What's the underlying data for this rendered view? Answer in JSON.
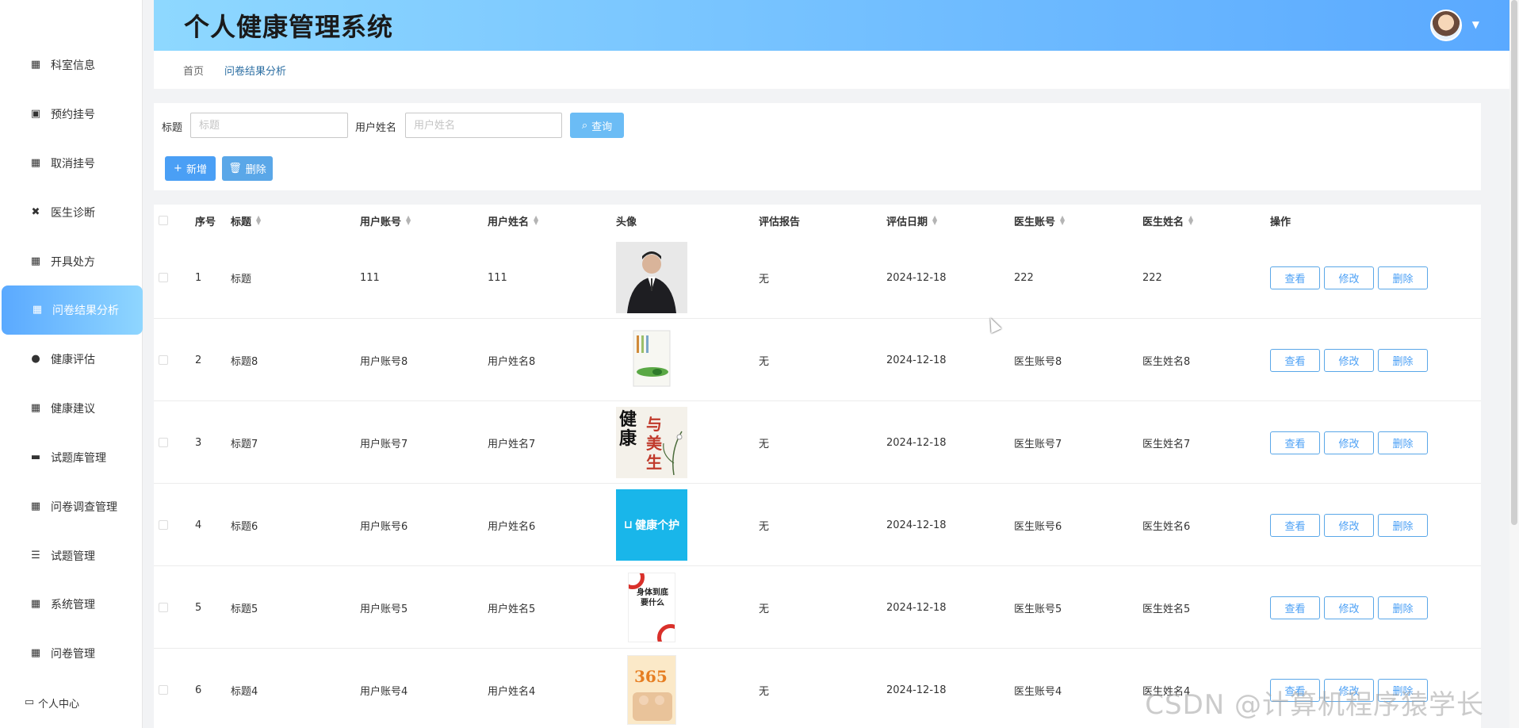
{
  "header": {
    "title": "个人健康管理系统"
  },
  "breadcrumb": {
    "home": "首页",
    "current": "问卷结果分析"
  },
  "sidebar": {
    "items": [
      {
        "label": "科室信息",
        "icon": "grid-icon"
      },
      {
        "label": "预约挂号",
        "icon": "clipboard-icon"
      },
      {
        "label": "取消挂号",
        "icon": "grid-icon"
      },
      {
        "label": "医生诊断",
        "icon": "ticket-icon"
      },
      {
        "label": "开具处方",
        "icon": "grid-icon"
      },
      {
        "label": "问卷结果分析",
        "icon": "grid-icon",
        "active": true
      },
      {
        "label": "健康评估",
        "icon": "user-icon"
      },
      {
        "label": "健康建议",
        "icon": "grid-icon"
      },
      {
        "label": "试题库管理",
        "icon": "monitor-icon"
      },
      {
        "label": "问卷调查管理",
        "icon": "grid-icon"
      },
      {
        "label": "试题管理",
        "icon": "list-icon"
      },
      {
        "label": "系统管理",
        "icon": "grid-icon"
      },
      {
        "label": "问卷管理",
        "icon": "grid-icon"
      }
    ],
    "personal": "个人中心"
  },
  "search": {
    "title_label": "标题",
    "title_placeholder": "标题",
    "name_label": "用户姓名",
    "name_placeholder": "用户姓名",
    "query_button": "查询",
    "add_button": "新增",
    "delete_button": "删除"
  },
  "table": {
    "headers": {
      "index": "序号",
      "title": "标题",
      "account": "用户账号",
      "name": "用户姓名",
      "avatar": "头像",
      "report": "评估报告",
      "date": "评估日期",
      "doctor_account": "医生账号",
      "doctor_name": "医生姓名",
      "actions": "操作"
    },
    "actions": {
      "view": "查看",
      "edit": "修改",
      "delete": "删除"
    },
    "rows": [
      {
        "index": "1",
        "title": "标题",
        "account": "111",
        "name": "111",
        "report": "无",
        "date": "2024-12-18",
        "doctor_account": "222",
        "doctor_name": "222",
        "image": "man-in-suit"
      },
      {
        "index": "2",
        "title": "标题8",
        "account": "用户账号8",
        "name": "用户姓名8",
        "report": "无",
        "date": "2024-12-18",
        "doctor_account": "医生账号8",
        "doctor_name": "医生姓名8",
        "image": "green-book"
      },
      {
        "index": "3",
        "title": "标题7",
        "account": "用户账号7",
        "name": "用户姓名7",
        "report": "无",
        "date": "2024-12-18",
        "doctor_account": "医生账号7",
        "doctor_name": "医生姓名7",
        "image": "health-calligraphy"
      },
      {
        "index": "4",
        "title": "标题6",
        "account": "用户账号6",
        "name": "用户姓名6",
        "report": "无",
        "date": "2024-12-18",
        "doctor_account": "医生账号6",
        "doctor_name": "医生姓名6",
        "image": "health-care-logo"
      },
      {
        "index": "5",
        "title": "标题5",
        "account": "用户账号5",
        "name": "用户姓名5",
        "report": "无",
        "date": "2024-12-18",
        "doctor_account": "医生账号5",
        "doctor_name": "医生姓名5",
        "image": "red-book"
      },
      {
        "index": "6",
        "title": "标题4",
        "account": "用户账号4",
        "name": "用户姓名4",
        "report": "无",
        "date": "2024-12-18",
        "doctor_account": "医生账号4",
        "doctor_name": "医生姓名4",
        "image": "elderly-book"
      }
    ]
  },
  "images": {
    "logo_text": "健康个护",
    "calligraphy_1": "健康",
    "calligraphy_2": "与美生",
    "red_book_title": "身体到底要什么",
    "elderly_book_title": "365"
  },
  "watermark": "CSDN @计算机程序猿学长",
  "colors": {
    "accent": "#4a9ff5",
    "header_start": "#8ed8ff",
    "header_end": "#5aa9ff"
  }
}
